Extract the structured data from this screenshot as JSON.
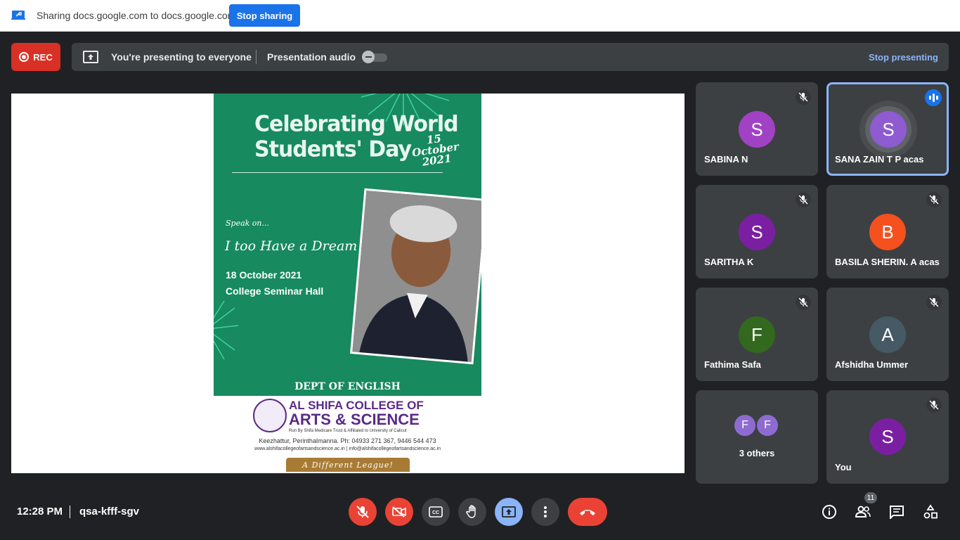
{
  "share_bar": {
    "text": "Sharing docs.google.com to docs.google.com",
    "stop_button": "Stop sharing"
  },
  "presenting_bar": {
    "rec_label": "REC",
    "status": "You're presenting to everyone",
    "audio_label": "Presentation audio",
    "audio_toggle": "off",
    "stop_label": "Stop presenting"
  },
  "poster": {
    "title_line1": "Celebrating World",
    "title_line2": "Students' Day",
    "date_day": "15",
    "date_month": "October",
    "date_year": "2021",
    "speak_on": "Speak on...",
    "talk_title": "I too Have a Dream",
    "event_date": "18 October 2021",
    "venue": "College Seminar Hall",
    "dept": "DEPT OF ENGLISH",
    "college_line1": "AL SHIFA COLLEGE OF",
    "college_line2": "ARTS & SCIENCE",
    "affiliation": "Run By Shifa Medicare Trust & Affiliated to University of Calicut",
    "address": "Keezhattur, Perinthalmanna. Ph: 04933 271 367, 9446 544 473",
    "websites": "www.alshifacollegeofartsandscience.ac.in | info@alshifacollegeofartsandscience.ac.in",
    "tagline": "A Different League!"
  },
  "participants": [
    {
      "name": "SABINA N",
      "initial": "S",
      "color": "#a142c4",
      "muted": true
    },
    {
      "name": "SANA ZAIN T P acas",
      "initial": "S",
      "color": "#8e5bd0",
      "speaking": true
    },
    {
      "name": "SARITHA K",
      "initial": "S",
      "color": "#7b1fa2",
      "muted": true
    },
    {
      "name": "BASILA SHERIN. A acas",
      "initial": "B",
      "color": "#f4511e",
      "muted": true
    },
    {
      "name": "Fathima Safa",
      "initial": "F",
      "color": "#33691e",
      "muted": true
    },
    {
      "name": "Afshidha Ummer",
      "initial": "A",
      "color": "#455a64",
      "muted": true
    },
    {
      "name": "You",
      "initial": "S",
      "color": "#7b1fa2",
      "muted": true
    }
  ],
  "others": {
    "label": "3 others",
    "initials": [
      "F",
      "F"
    ]
  },
  "bottom": {
    "time": "12:28 PM",
    "meeting_code": "qsa-kfff-sgv",
    "people_count": "11"
  },
  "colors": {
    "accent": "#8ab4f8",
    "danger": "#ea4335",
    "tile": "#3c4043",
    "background": "#202124"
  }
}
